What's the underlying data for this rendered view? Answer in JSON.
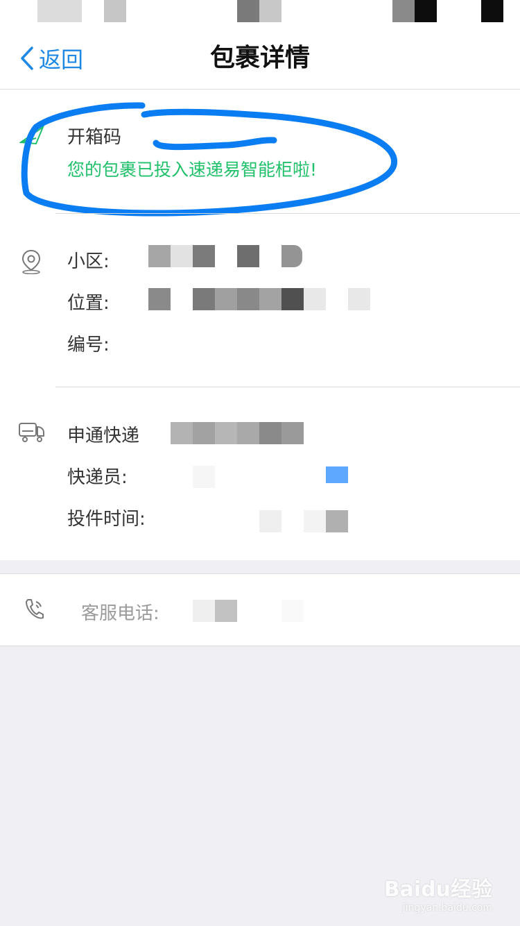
{
  "nav": {
    "back_label": "返回",
    "title": "包裹详情"
  },
  "notice": {
    "code_label": "开箱码",
    "message": "您的包裹已投入速递易智能柜啦!"
  },
  "location": {
    "community_label": "小区:",
    "position_label": "位置:",
    "number_label": "编号:"
  },
  "courier": {
    "company": "申通快递",
    "courier_label": "快递员:",
    "time_label": "投件时间:"
  },
  "service": {
    "phone_label": "客服电话:"
  },
  "watermark": {
    "brand": "Baidu经验",
    "url": "jingyan.baidu.com"
  },
  "colors": {
    "accent": "#1e88e5",
    "success": "#21c06b",
    "highlight_ink": "#0a7df2"
  }
}
